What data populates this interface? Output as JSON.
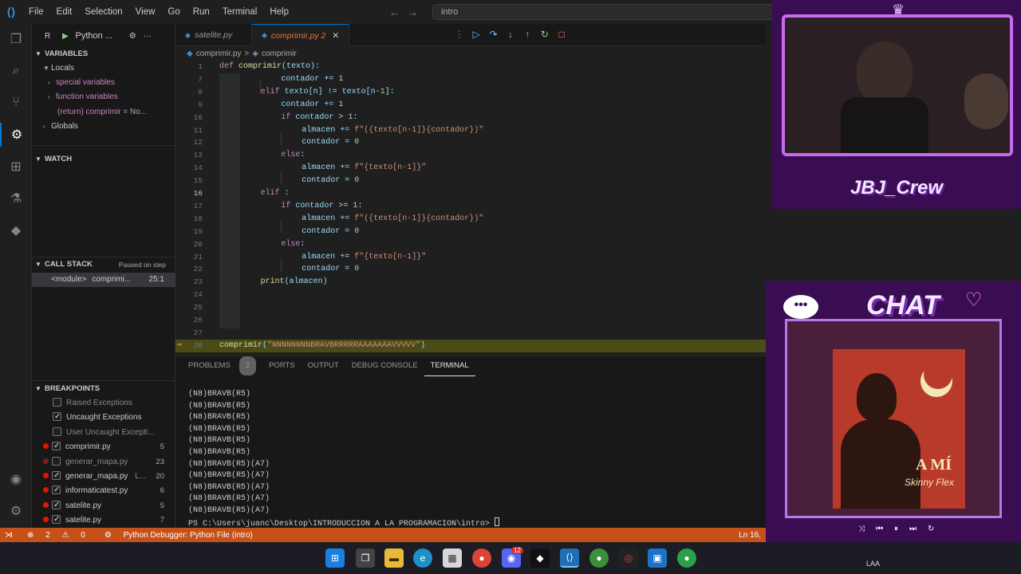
{
  "menu": [
    "File",
    "Edit",
    "Selection",
    "View",
    "Go",
    "Run",
    "Terminal",
    "Help"
  ],
  "search_text": "intro",
  "sidebar": {
    "run_label": "R",
    "config": "Python ...",
    "variables_title": "VARIABLES",
    "locals": "Locals",
    "special_vars": "special variables",
    "function_vars": "function variables",
    "return_name": "(return) comprimir",
    "return_value": "= No...",
    "globals": "Globals",
    "watch_title": "WATCH",
    "callstack_title": "CALL STACK",
    "callstack_status": "Paused on step",
    "frame_module": "<module>",
    "frame_fn": "comprimi...",
    "frame_pos": "25:1",
    "breakpoints_title": "BREAKPOINTS",
    "breakpoints": [
      {
        "label": "Raised Exceptions",
        "checked": false,
        "dot": false,
        "count": ""
      },
      {
        "label": "Uncaught Exceptions",
        "checked": true,
        "dot": false,
        "count": ""
      },
      {
        "label": "User Uncaught Excepti...",
        "checked": false,
        "dot": false,
        "count": ""
      },
      {
        "label": "comprimir.py",
        "checked": true,
        "dot": true,
        "count": "5"
      },
      {
        "label": "generar_mapa.py",
        "checked": false,
        "dot": true,
        "count": "23"
      },
      {
        "label": "generar_mapa.py",
        "extra": "L...",
        "checked": true,
        "dot": true,
        "count": "20"
      },
      {
        "label": "informaticatest.py",
        "checked": true,
        "dot": true,
        "count": "6"
      },
      {
        "label": "satelite.py",
        "checked": true,
        "dot": true,
        "count": "5"
      },
      {
        "label": "satelite.py",
        "checked": true,
        "dot": true,
        "count": "7"
      }
    ]
  },
  "tabs": [
    {
      "label": "satelite.py",
      "active": false,
      "mod": ""
    },
    {
      "label": "comprimir.py",
      "active": true,
      "mod": "2"
    }
  ],
  "breadcrumb": {
    "file": "comprimir.py",
    "sep": ">",
    "symbol": "comprimir"
  },
  "editor_lines": [
    {
      "n": "1",
      "code": "def comprimir(texto):"
    },
    {
      "n": "7",
      "code": "contador += 1"
    },
    {
      "n": "8",
      "code": "elif texto[n] != texto[n-1]:"
    },
    {
      "n": "9",
      "code": "contador += 1"
    },
    {
      "n": "10",
      "code": "if contador > 1:"
    },
    {
      "n": "11",
      "code": "almacen += f\"({texto[n-1]}{contador})\""
    },
    {
      "n": "12",
      "code": "contador = 0"
    },
    {
      "n": "13",
      "code": "else:"
    },
    {
      "n": "14",
      "code": "almacen += f\"{texto[n-1]}\""
    },
    {
      "n": "15",
      "code": "contador = 0"
    },
    {
      "n": "16",
      "code": "elif :"
    },
    {
      "n": "17",
      "code": "if contador >= 1:"
    },
    {
      "n": "18",
      "code": "almacen += f\"({texto[n-1]}{contador})\""
    },
    {
      "n": "19",
      "code": "contador = 0"
    },
    {
      "n": "20",
      "code": "else:"
    },
    {
      "n": "21",
      "code": "almacen += f\"{texto[n-1]}\""
    },
    {
      "n": "22",
      "code": "contador = 0"
    },
    {
      "n": "23",
      "code": "print(almacen)"
    },
    {
      "n": "24",
      "code": ""
    },
    {
      "n": "25",
      "code": ""
    },
    {
      "n": "26",
      "code": ""
    },
    {
      "n": "27",
      "code": ""
    },
    {
      "n": "28",
      "code": "comprimir(\"NNNNNNNNBRAVBRRRRRAAAAAAAVVVVV\")"
    }
  ],
  "panel": {
    "tabs": [
      "PROBLEMS",
      "PORTS",
      "OUTPUT",
      "DEBUG CONSOLE",
      "TERMINAL"
    ],
    "problems_count": "2",
    "terminal_lines": [
      "(N8)BRAVB(R5)",
      "(N8)BRAVB(R5)",
      "(N8)BRAVB(R5)",
      "(N8)BRAVB(R5)",
      "(N8)BRAVB(R5)",
      "(N8)BRAVB(R5)",
      "(N8)BRAVB(R5)(A7)",
      "(N8)BRAVB(R5)(A7)",
      "(N8)BRAVB(R5)(A7)",
      "(N8)BRAVB(R5)(A7)",
      "(N8)BRAVB(R5)(A7)"
    ],
    "prompt": "PS C:\\Users\\juanc\\Desktop\\INTRODUCCION A LA PROGRAMACION\\intro>"
  },
  "status": {
    "errors": "2",
    "warnings": "0",
    "debugger": "Python Debugger: Python File (intro)",
    "position": "Ln 16,"
  },
  "overlay": {
    "crew": "JBJ_Crew",
    "chat": "CHAT",
    "album_title": "A MÍ",
    "album_artist": "Skinny Flex",
    "tray": "LAA",
    "colors": {
      "frame": "#c66bf0",
      "bg": "#3a0d52",
      "album": "#b83a2a"
    }
  },
  "taskbar_badge": "12"
}
